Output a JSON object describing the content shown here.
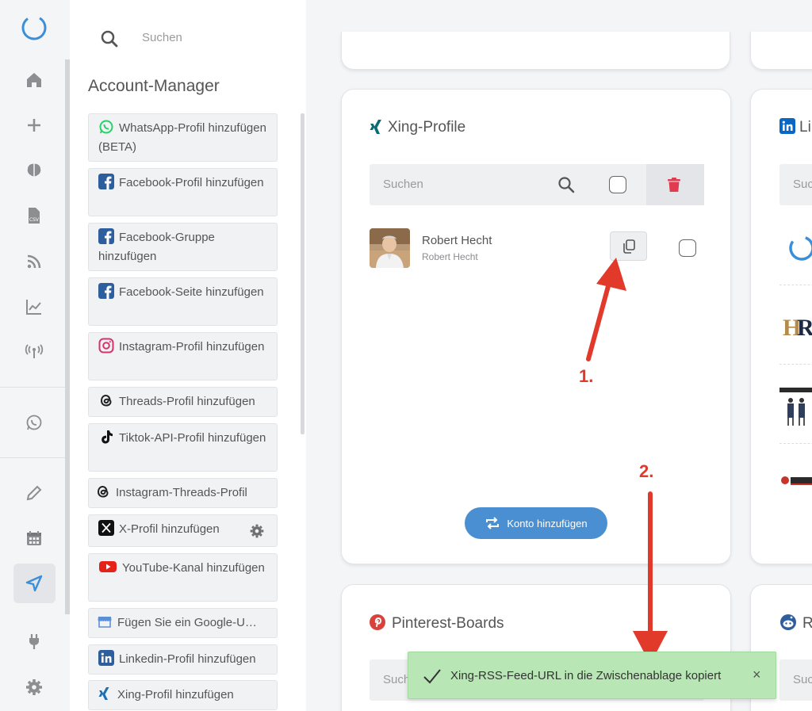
{
  "search": {
    "placeholder": "Suchen"
  },
  "panel": {
    "title": "Account-Manager",
    "items": [
      {
        "label": "WhatsApp-Profil hinzufügen (BETA)",
        "icon": "whatsapp-icon"
      },
      {
        "label": "Facebook-Profil hinzufügen",
        "icon": "facebook-icon"
      },
      {
        "label": "Facebook-Gruppe hinzufügen",
        "icon": "facebook-icon"
      },
      {
        "label": "Facebook-Seite hinzufügen",
        "icon": "facebook-icon"
      },
      {
        "label": "Instagram-Profil hinzufügen",
        "icon": "instagram-icon"
      },
      {
        "label": "Threads-Profil hinzufügen",
        "icon": "threads-icon"
      },
      {
        "label": "Tiktok-API-Profil hinzufügen",
        "icon": "tiktok-icon"
      },
      {
        "label": "Instagram-Threads-Profil",
        "icon": "threads-icon"
      },
      {
        "label": "X-Profil hinzufügen",
        "icon": "x-icon"
      },
      {
        "label": "YouTube-Kanal hinzufügen",
        "icon": "youtube-icon"
      },
      {
        "label": "Fügen Sie ein Google-U…",
        "icon": "google-business-icon"
      },
      {
        "label": "Linkedin-Profil hinzufügen",
        "icon": "linkedin-icon"
      },
      {
        "label": "Xing-Profil hinzufügen",
        "icon": "xing-icon"
      }
    ]
  },
  "xing_card": {
    "title": "Xing-Profile",
    "search_placeholder": "Suchen",
    "profile": {
      "name": "Robert Hecht",
      "subtitle": "Robert Hecht"
    },
    "add_button": "Konto hinzufügen"
  },
  "linkedin_card": {
    "title": "Li",
    "search_placeholder": "Suc"
  },
  "pinterest_card": {
    "title": "Pinterest-Boards",
    "search_placeholder": "Such"
  },
  "reddit_card": {
    "title": "R",
    "search_placeholder": "Suc"
  },
  "annotations": {
    "step1": "1.",
    "step2": "2."
  },
  "toast": {
    "message": "Xing-RSS-Feed-URL in die Zwischenablage kopiert",
    "close": "×"
  },
  "colors": {
    "accent": "#4a8fd1",
    "xing": "#0b6a73",
    "linkedin": "#0a66c2",
    "danger": "#e03b4f",
    "annotation": "#e23a2a",
    "toast_bg": "#b9e6b5"
  }
}
